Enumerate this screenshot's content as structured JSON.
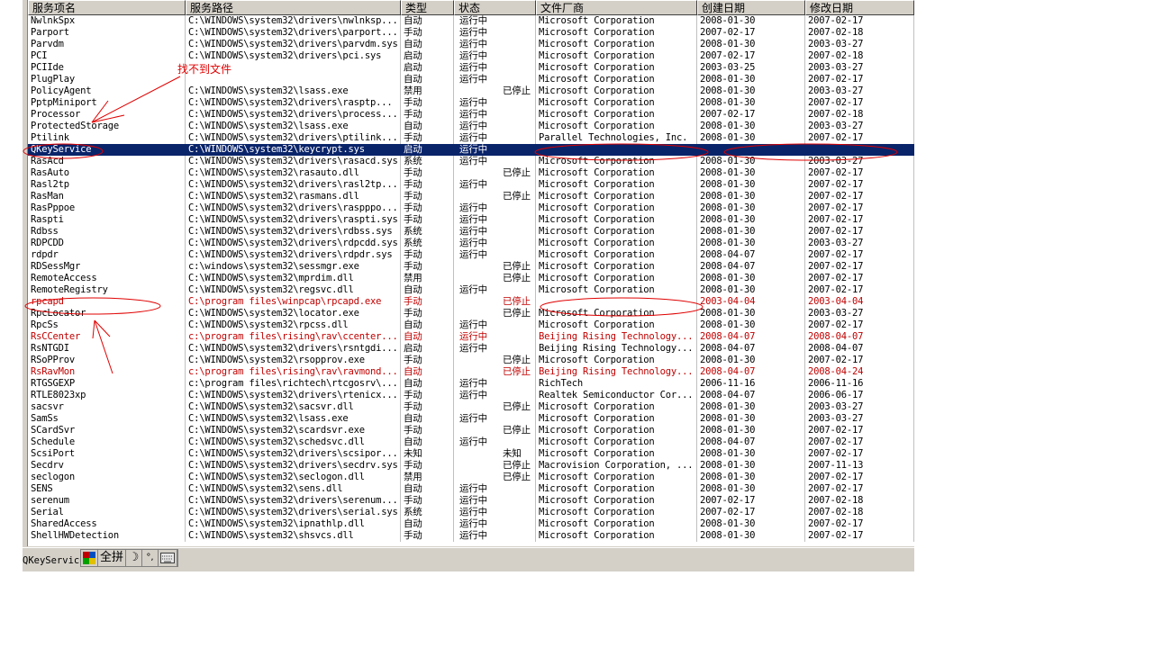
{
  "columns": [
    "服务项名",
    "服务路径",
    "类型",
    "状态",
    "文件厂商",
    "创建日期",
    "修改日期"
  ],
  "rows": [
    {
      "name": "NwlnkSpx",
      "path": "C:\\WINDOWS\\system32\\drivers\\nwlnksp...",
      "type": "自动",
      "state": "运行中",
      "state2": "",
      "vendor": "Microsoft Corporation",
      "created": "2008-01-30",
      "modified": "2007-02-17",
      "style": ""
    },
    {
      "name": "Parport",
      "path": "C:\\WINDOWS\\system32\\drivers\\parport...",
      "type": "手动",
      "state": "运行中",
      "state2": "",
      "vendor": "Microsoft Corporation",
      "created": "2007-02-17",
      "modified": "2007-02-18",
      "style": ""
    },
    {
      "name": "Parvdm",
      "path": "C:\\WINDOWS\\system32\\drivers\\parvdm.sys",
      "type": "自动",
      "state": "运行中",
      "state2": "",
      "vendor": "Microsoft Corporation",
      "created": "2008-01-30",
      "modified": "2003-03-27",
      "style": ""
    },
    {
      "name": "PCI",
      "path": "C:\\WINDOWS\\system32\\drivers\\pci.sys",
      "type": "启动",
      "state": "运行中",
      "state2": "",
      "vendor": "Microsoft Corporation",
      "created": "2007-02-17",
      "modified": "2007-02-18",
      "style": ""
    },
    {
      "name": "PCIIde",
      "path": "",
      "type": "启动",
      "state": "运行中",
      "state2": "",
      "vendor": "Microsoft Corporation",
      "created": "2003-03-25",
      "modified": "2003-03-27",
      "style": ""
    },
    {
      "name": "PlugPlay",
      "path": "",
      "type": "自动",
      "state": "运行中",
      "state2": "",
      "vendor": "Microsoft Corporation",
      "created": "2008-01-30",
      "modified": "2007-02-17",
      "style": ""
    },
    {
      "name": "PolicyAgent",
      "path": "C:\\WINDOWS\\system32\\lsass.exe",
      "type": "禁用",
      "state": "",
      "state2": "已停止",
      "vendor": "Microsoft Corporation",
      "created": "2008-01-30",
      "modified": "2003-03-27",
      "style": ""
    },
    {
      "name": "PptpMiniport",
      "path": "C:\\WINDOWS\\system32\\drivers\\rasptp...",
      "type": "手动",
      "state": "运行中",
      "state2": "",
      "vendor": "Microsoft Corporation",
      "created": "2008-01-30",
      "modified": "2007-02-17",
      "style": ""
    },
    {
      "name": "Processor",
      "path": "C:\\WINDOWS\\system32\\drivers\\process...",
      "type": "手动",
      "state": "运行中",
      "state2": "",
      "vendor": "Microsoft Corporation",
      "created": "2007-02-17",
      "modified": "2007-02-18",
      "style": ""
    },
    {
      "name": "ProtectedStorage",
      "path": "C:\\WINDOWS\\system32\\lsass.exe",
      "type": "自动",
      "state": "运行中",
      "state2": "",
      "vendor": "Microsoft Corporation",
      "created": "2008-01-30",
      "modified": "2003-03-27",
      "style": ""
    },
    {
      "name": "Ptilink",
      "path": "C:\\WINDOWS\\system32\\drivers\\ptilink...",
      "type": "手动",
      "state": "运行中",
      "state2": "",
      "vendor": "Parallel Technologies, Inc.",
      "created": "2008-01-30",
      "modified": "2007-02-17",
      "style": ""
    },
    {
      "name": "QKeyService",
      "path": "C:\\WINDOWS\\system32\\keycrypt.sys",
      "type": "启动",
      "state": "运行中",
      "state2": "",
      "vendor": "",
      "created": "",
      "modified": "",
      "style": "sel"
    },
    {
      "name": "RasAcd",
      "path": "C:\\WINDOWS\\system32\\drivers\\rasacd.sys",
      "type": "系统",
      "state": "运行中",
      "state2": "",
      "vendor": "Microsoft Corporation",
      "created": "2008-01-30",
      "modified": "2003-03-27",
      "style": ""
    },
    {
      "name": "RasAuto",
      "path": "C:\\WINDOWS\\system32\\rasauto.dll",
      "type": "手动",
      "state": "",
      "state2": "已停止",
      "vendor": "Microsoft Corporation",
      "created": "2008-01-30",
      "modified": "2007-02-17",
      "style": ""
    },
    {
      "name": "Rasl2tp",
      "path": "C:\\WINDOWS\\system32\\drivers\\rasl2tp...",
      "type": "手动",
      "state": "运行中",
      "state2": "",
      "vendor": "Microsoft Corporation",
      "created": "2008-01-30",
      "modified": "2007-02-17",
      "style": ""
    },
    {
      "name": "RasMan",
      "path": "C:\\WINDOWS\\system32\\rasmans.dll",
      "type": "手动",
      "state": "",
      "state2": "已停止",
      "vendor": "Microsoft Corporation",
      "created": "2008-01-30",
      "modified": "2007-02-17",
      "style": ""
    },
    {
      "name": "RasPppoe",
      "path": "C:\\WINDOWS\\system32\\drivers\\raspppo...",
      "type": "手动",
      "state": "运行中",
      "state2": "",
      "vendor": "Microsoft Corporation",
      "created": "2008-01-30",
      "modified": "2007-02-17",
      "style": ""
    },
    {
      "name": "Raspti",
      "path": "C:\\WINDOWS\\system32\\drivers\\raspti.sys",
      "type": "手动",
      "state": "运行中",
      "state2": "",
      "vendor": "Microsoft Corporation",
      "created": "2008-01-30",
      "modified": "2007-02-17",
      "style": ""
    },
    {
      "name": "Rdbss",
      "path": "C:\\WINDOWS\\system32\\drivers\\rdbss.sys",
      "type": "系统",
      "state": "运行中",
      "state2": "",
      "vendor": "Microsoft Corporation",
      "created": "2008-01-30",
      "modified": "2007-02-17",
      "style": ""
    },
    {
      "name": "RDPCDD",
      "path": "C:\\WINDOWS\\system32\\drivers\\rdpcdd.sys",
      "type": "系统",
      "state": "运行中",
      "state2": "",
      "vendor": "Microsoft Corporation",
      "created": "2008-01-30",
      "modified": "2003-03-27",
      "style": ""
    },
    {
      "name": "rdpdr",
      "path": "C:\\WINDOWS\\system32\\drivers\\rdpdr.sys",
      "type": "手动",
      "state": "运行中",
      "state2": "",
      "vendor": "Microsoft Corporation",
      "created": "2008-04-07",
      "modified": "2007-02-17",
      "style": ""
    },
    {
      "name": "RDSessMgr",
      "path": "c:\\windows\\system32\\sessmgr.exe",
      "type": "手动",
      "state": "",
      "state2": "已停止",
      "vendor": "Microsoft Corporation",
      "created": "2008-04-07",
      "modified": "2007-02-17",
      "style": ""
    },
    {
      "name": "RemoteAccess",
      "path": "C:\\WINDOWS\\system32\\mprdim.dll",
      "type": "禁用",
      "state": "",
      "state2": "已停止",
      "vendor": "Microsoft Corporation",
      "created": "2008-01-30",
      "modified": "2007-02-17",
      "style": ""
    },
    {
      "name": "RemoteRegistry",
      "path": "C:\\WINDOWS\\system32\\regsvc.dll",
      "type": "自动",
      "state": "运行中",
      "state2": "",
      "vendor": "Microsoft Corporation",
      "created": "2008-01-30",
      "modified": "2007-02-17",
      "style": ""
    },
    {
      "name": "rpcapd",
      "path": "C:\\program files\\winpcap\\rpcapd.exe",
      "type": "手动",
      "state": "",
      "state2": "已停止",
      "vendor": "",
      "created": "2003-04-04",
      "modified": "2003-04-04",
      "style": "red"
    },
    {
      "name": "RpcLocator",
      "path": "C:\\WINDOWS\\system32\\locator.exe",
      "type": "手动",
      "state": "",
      "state2": "已停止",
      "vendor": "Microsoft Corporation",
      "created": "2008-01-30",
      "modified": "2003-03-27",
      "style": ""
    },
    {
      "name": "RpcSs",
      "path": "C:\\WINDOWS\\system32\\rpcss.dll",
      "type": "自动",
      "state": "运行中",
      "state2": "",
      "vendor": "Microsoft Corporation",
      "created": "2008-01-30",
      "modified": "2007-02-17",
      "style": ""
    },
    {
      "name": "RsCCenter",
      "path": "c:\\program files\\rising\\rav\\ccenter...",
      "type": "自动",
      "state": "运行中",
      "state2": "",
      "vendor": "Beijing Rising Technology...",
      "created": "2008-04-07",
      "modified": "2008-04-07",
      "style": "red"
    },
    {
      "name": "RsNTGDI",
      "path": "C:\\WINDOWS\\system32\\drivers\\rsntgdi...",
      "type": "启动",
      "state": "运行中",
      "state2": "",
      "vendor": "Beijing Rising Technology...",
      "created": "2008-04-07",
      "modified": "2008-04-07",
      "style": ""
    },
    {
      "name": "RSoPProv",
      "path": "C:\\WINDOWS\\system32\\rsopprov.exe",
      "type": "手动",
      "state": "",
      "state2": "已停止",
      "vendor": "Microsoft Corporation",
      "created": "2008-01-30",
      "modified": "2007-02-17",
      "style": ""
    },
    {
      "name": "RsRavMon",
      "path": "c:\\program files\\rising\\rav\\ravmond...",
      "type": "自动",
      "state": "",
      "state2": "已停止",
      "vendor": "Beijing Rising Technology...",
      "created": "2008-04-07",
      "modified": "2008-04-24",
      "style": "red"
    },
    {
      "name": "RTGSGEXP",
      "path": "c:\\program files\\richtech\\rtcgosrv\\...",
      "type": "自动",
      "state": "运行中",
      "state2": "",
      "vendor": "RichTech",
      "created": "2006-11-16",
      "modified": "2006-11-16",
      "style": ""
    },
    {
      "name": "RTLE8023xp",
      "path": "C:\\WINDOWS\\system32\\drivers\\rtenicx...",
      "type": "手动",
      "state": "运行中",
      "state2": "",
      "vendor": "Realtek Semiconductor Cor...",
      "created": "2008-04-07",
      "modified": "2006-06-17",
      "style": ""
    },
    {
      "name": "sacsvr",
      "path": "C:\\WINDOWS\\system32\\sacsvr.dll",
      "type": "手动",
      "state": "",
      "state2": "已停止",
      "vendor": "Microsoft Corporation",
      "created": "2008-01-30",
      "modified": "2003-03-27",
      "style": ""
    },
    {
      "name": "SamSs",
      "path": "C:\\WINDOWS\\system32\\lsass.exe",
      "type": "自动",
      "state": "运行中",
      "state2": "",
      "vendor": "Microsoft Corporation",
      "created": "2008-01-30",
      "modified": "2003-03-27",
      "style": ""
    },
    {
      "name": "SCardSvr",
      "path": "C:\\WINDOWS\\system32\\scardsvr.exe",
      "type": "手动",
      "state": "",
      "state2": "已停止",
      "vendor": "Microsoft Corporation",
      "created": "2008-01-30",
      "modified": "2007-02-17",
      "style": ""
    },
    {
      "name": "Schedule",
      "path": "C:\\WINDOWS\\system32\\schedsvc.dll",
      "type": "自动",
      "state": "运行中",
      "state2": "",
      "vendor": "Microsoft Corporation",
      "created": "2008-04-07",
      "modified": "2007-02-17",
      "style": ""
    },
    {
      "name": "ScsiPort",
      "path": "C:\\WINDOWS\\system32\\drivers\\scsipor...",
      "type": "未知",
      "state": "",
      "state2": "未知",
      "vendor": "Microsoft Corporation",
      "created": "2008-01-30",
      "modified": "2007-02-17",
      "style": ""
    },
    {
      "name": "Secdrv",
      "path": "C:\\WINDOWS\\system32\\drivers\\secdrv.sys",
      "type": "手动",
      "state": "",
      "state2": "已停止",
      "vendor": "Macrovision Corporation, ...",
      "created": "2008-01-30",
      "modified": "2007-11-13",
      "style": ""
    },
    {
      "name": "seclogon",
      "path": "C:\\WINDOWS\\system32\\seclogon.dll",
      "type": "禁用",
      "state": "",
      "state2": "已停止",
      "vendor": "Microsoft Corporation",
      "created": "2008-01-30",
      "modified": "2007-02-17",
      "style": ""
    },
    {
      "name": "SENS",
      "path": "C:\\WINDOWS\\system32\\sens.dll",
      "type": "自动",
      "state": "运行中",
      "state2": "",
      "vendor": "Microsoft Corporation",
      "created": "2008-01-30",
      "modified": "2007-02-17",
      "style": ""
    },
    {
      "name": "serenum",
      "path": "C:\\WINDOWS\\system32\\drivers\\serenum...",
      "type": "手动",
      "state": "运行中",
      "state2": "",
      "vendor": "Microsoft Corporation",
      "created": "2007-02-17",
      "modified": "2007-02-18",
      "style": ""
    },
    {
      "name": "Serial",
      "path": "C:\\WINDOWS\\system32\\drivers\\serial.sys",
      "type": "系统",
      "state": "运行中",
      "state2": "",
      "vendor": "Microsoft Corporation",
      "created": "2007-02-17",
      "modified": "2007-02-18",
      "style": ""
    },
    {
      "name": "SharedAccess",
      "path": "C:\\WINDOWS\\system32\\ipnathlp.dll",
      "type": "自动",
      "state": "运行中",
      "state2": "",
      "vendor": "Microsoft Corporation",
      "created": "2008-01-30",
      "modified": "2007-02-17",
      "style": ""
    },
    {
      "name": "ShellHWDetection",
      "path": "C:\\WINDOWS\\system32\\shsvcs.dll",
      "type": "手动",
      "state": "运行中",
      "state2": "",
      "vendor": "Microsoft Corporation",
      "created": "2008-01-30",
      "modified": "2007-02-17",
      "style": ""
    }
  ],
  "status_bar": {
    "text": "QKeyService",
    "ime": {
      "mode": "全拼",
      "moon": "☽",
      "punct": "°,"
    }
  },
  "annotation": {
    "label": "找不到文件",
    "color": "#e00000"
  }
}
